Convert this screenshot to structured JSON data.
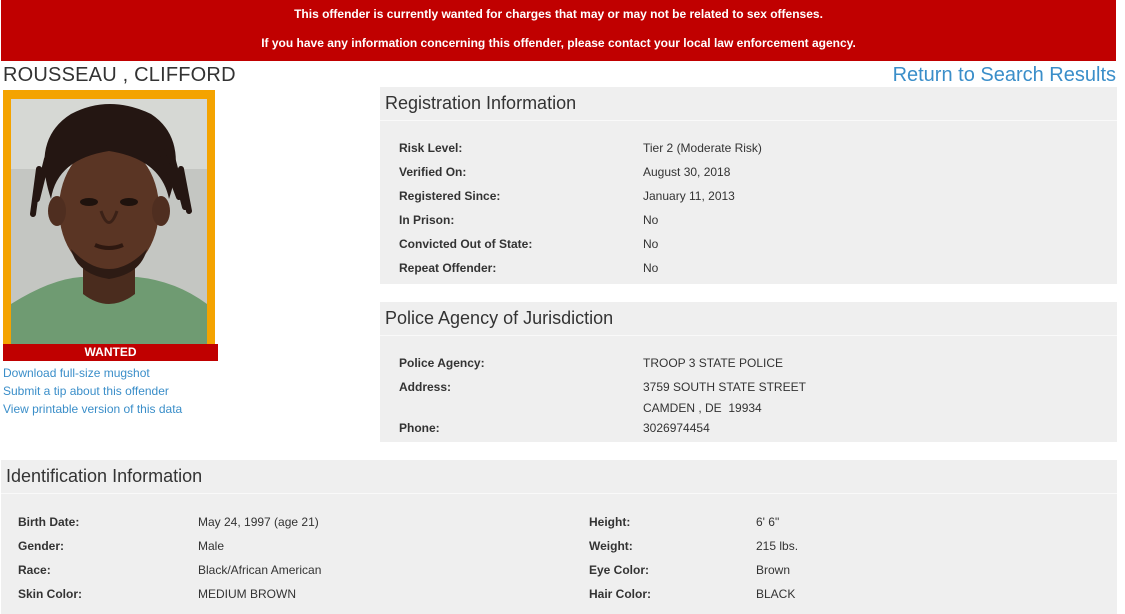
{
  "alert": {
    "line1": "This offender is currently wanted for charges that may or may not be related to sex offenses.",
    "line2": "If you have any information concerning this offender, please contact your local law enforcement agency."
  },
  "offender_name": "ROUSSEAU , CLIFFORD",
  "return_link": "Return to Search Results",
  "wanted_label": "WANTED",
  "links": {
    "download": "Download full-size mugshot",
    "tip": "Submit a tip about this offender",
    "printable": "View printable version of this data"
  },
  "registration": {
    "title": "Registration Information",
    "rows": [
      {
        "label": "Risk Level:",
        "value": "Tier 2 (Moderate Risk)"
      },
      {
        "label": "Verified On:",
        "value": "August 30, 2018"
      },
      {
        "label": "Registered Since:",
        "value": "January 11, 2013"
      },
      {
        "label": "In Prison:",
        "value": "No"
      },
      {
        "label": "Convicted Out of State:",
        "value": "No"
      },
      {
        "label": "Repeat Offender:",
        "value": "No"
      }
    ]
  },
  "police": {
    "title": "Police Agency of Jurisdiction",
    "agency_label": "Police Agency:",
    "agency_value": "TROOP 3 STATE POLICE",
    "address_label": "Address:",
    "address_line1": "3759 SOUTH STATE STREET",
    "address_line2": "CAMDEN , DE  19934",
    "phone_label": "Phone:",
    "phone_value": "3026974454"
  },
  "identification": {
    "title": "Identification Information",
    "left": [
      {
        "label": "Birth Date:",
        "value": "May 24, 1997 (age 21)"
      },
      {
        "label": "Gender:",
        "value": "Male"
      },
      {
        "label": "Race:",
        "value": "Black/African American"
      },
      {
        "label": "Skin Color:",
        "value": "MEDIUM BROWN"
      }
    ],
    "right": [
      {
        "label": "Height:",
        "value": "6' 6\""
      },
      {
        "label": "Weight:",
        "value": "215 lbs."
      },
      {
        "label": "Eye Color:",
        "value": "Brown"
      },
      {
        "label": "Hair Color:",
        "value": "BLACK"
      }
    ]
  }
}
